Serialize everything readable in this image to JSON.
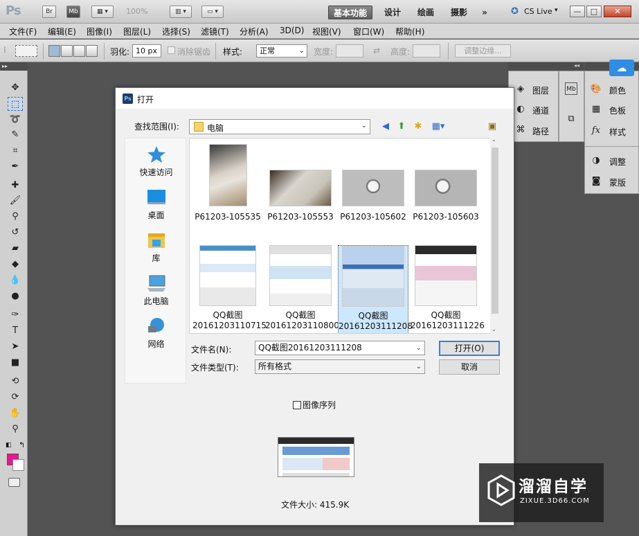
{
  "app": {
    "logo": "Ps",
    "br_button": "Br",
    "mb_button": "Mb",
    "zoom": "100%",
    "workspaces": [
      "基本功能",
      "设计",
      "绘画",
      "摄影"
    ],
    "overflow": "»",
    "cslive": "CS Live",
    "window_buttons": [
      "—",
      "□",
      "✕"
    ]
  },
  "menu": [
    "文件(F)",
    "编辑(E)",
    "图像(I)",
    "图层(L)",
    "选择(S)",
    "滤镜(T)",
    "分析(A)",
    "3D(D)",
    "视图(V)",
    "窗口(W)",
    "帮助(H)"
  ],
  "options": {
    "feather_label": "羽化:",
    "feather_value": "10 px",
    "antialias_label": "消除锯齿",
    "style_label": "样式:",
    "style_value": "正常",
    "width_label": "宽度:",
    "height_label": "高度:",
    "refine_edge": "调整边缘..."
  },
  "panels": {
    "group1": [
      "图层",
      "通道",
      "路径"
    ],
    "group2": [
      "颜色",
      "色板",
      "样式"
    ],
    "group3": [
      "调整",
      "蒙版"
    ]
  },
  "colors": {
    "foreground": "#ea1590",
    "background": "#ffffff",
    "accent": "#3c7fd6"
  },
  "dialog": {
    "title": "打开",
    "lookin_label": "查找范围(I):",
    "lookin_value": "电脑",
    "places": [
      "快速访问",
      "桌面",
      "库",
      "此电脑",
      "网络"
    ],
    "files": [
      {
        "name": "P61203-105535",
        "kind": "photo-tall"
      },
      {
        "name": "P61203-105553",
        "kind": "photo"
      },
      {
        "name": "P61203-105602",
        "kind": "photo-grey"
      },
      {
        "name": "P61203-105603",
        "kind": "photo-grey"
      },
      {
        "name1": "QQ截图",
        "name2": "20161203110715",
        "kind": "screen"
      },
      {
        "name1": "QQ截图",
        "name2": "20161203110800",
        "kind": "screen"
      },
      {
        "name1": "QQ截图",
        "name2": "20161203111208",
        "kind": "screen",
        "selected": true
      },
      {
        "name1": "QQ截图",
        "name2": "20161203111226",
        "kind": "screen"
      }
    ],
    "filename_label": "文件名(N):",
    "filename_value": "QQ截图20161203111208",
    "filetype_label": "文件类型(T):",
    "filetype_value": "所有格式",
    "open_button": "打开(O)",
    "cancel_button": "取消",
    "sequence_label": "图像序列",
    "filesize": "文件大小: 415.9K"
  },
  "watermark": {
    "title": "溜溜自学",
    "url": "ZIXUE.3D66.COM"
  }
}
